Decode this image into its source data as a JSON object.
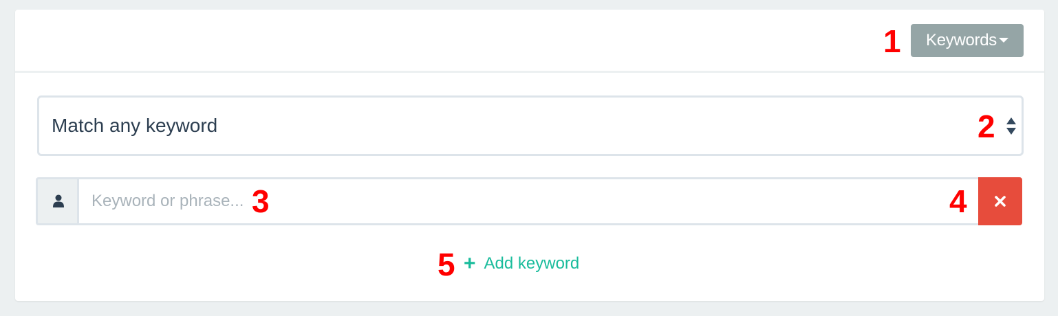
{
  "header": {
    "keywords_button_label": "Keywords"
  },
  "annotations": {
    "n1": "1",
    "n2": "2",
    "n3": "3",
    "n4": "4",
    "n5": "5"
  },
  "match_select": {
    "selected": "Match any keyword"
  },
  "keyword_row": {
    "addon_icon": "user-icon",
    "placeholder": "Keyword or phrase...",
    "value": "",
    "remove_icon": "close-icon"
  },
  "add_keyword": {
    "icon": "+",
    "label": "Add keyword"
  },
  "colors": {
    "background": "#ecf0f1",
    "keywords_button": "#95a5a6",
    "remove_button": "#e74c3c",
    "link_accent": "#1abc9c",
    "annotation": "#ff0000",
    "text": "#2c3e50"
  }
}
